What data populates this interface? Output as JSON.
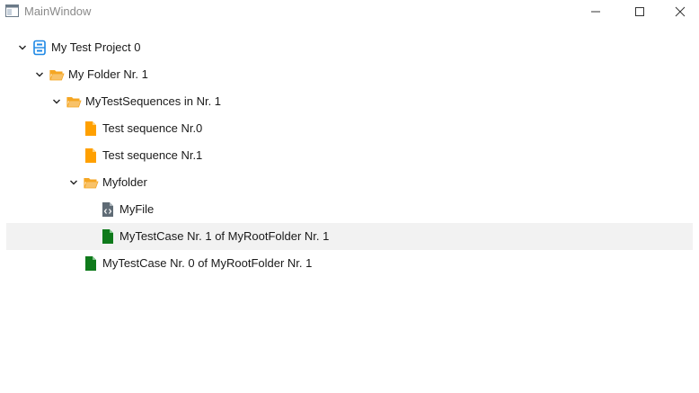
{
  "window": {
    "title": "MainWindow",
    "controls": {
      "minimize": "minimize-icon",
      "maximize": "maximize-icon",
      "close": "close-icon"
    }
  },
  "colors": {
    "project": "#1e88e5",
    "folder": "#f5a623",
    "sequence": "#ffa000",
    "testcase": "#0f7a1b",
    "file": "#5f6b75",
    "selection": "#f2f2f2"
  },
  "tree": {
    "project_label": "My Test Project 0",
    "folder1_label": "My Folder Nr. 1",
    "sequences_folder_label": "MyTestSequences in Nr. 1",
    "seq0_label": "Test sequence Nr.0",
    "seq1_label": "Test sequence Nr.1",
    "myfolder_label": "Myfolder",
    "myfile_label": "MyFile",
    "testcase1_label": "MyTestCase Nr. 1 of MyRootFolder Nr. 1",
    "testcase0_label": "MyTestCase Nr. 0 of MyRootFolder Nr. 1"
  }
}
